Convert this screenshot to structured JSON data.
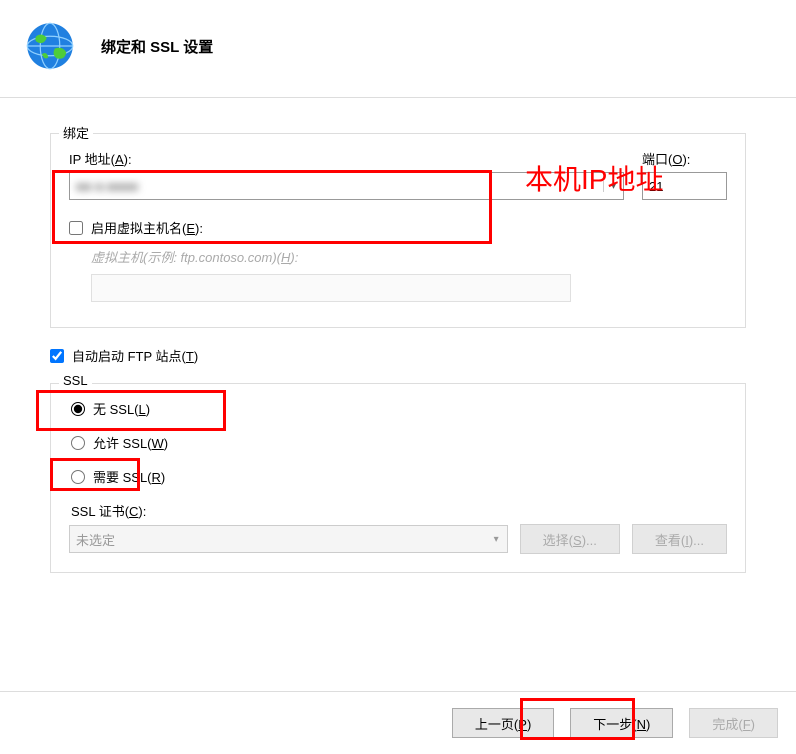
{
  "header": {
    "title": "绑定和 SSL 设置"
  },
  "binding": {
    "legend": "绑定",
    "ip_label_pre": "IP 地址(",
    "ip_hotkey": "A",
    "ip_label_post": "):",
    "ip_value": "■■  ■.■■■■",
    "port_label_pre": "端口(",
    "port_hotkey": "O",
    "port_label_post": "):",
    "port_value": "21",
    "vhost_enable_pre": "启用虚拟主机名(",
    "vhost_enable_hotkey": "E",
    "vhost_enable_post": "):",
    "vhost_enable_checked": false,
    "vhost_hint_pre": "虚拟主机(示例: ftp.contoso.com)(",
    "vhost_hint_hotkey": "H",
    "vhost_hint_post": "):"
  },
  "autostart": {
    "label_pre": "自动启动 FTP 站点(",
    "hotkey": "T",
    "label_post": ")",
    "checked": true
  },
  "ssl": {
    "legend": "SSL",
    "none_pre": "无 SSL(",
    "none_hotkey": "L",
    "none_post": ")",
    "allow_pre": "允许 SSL(",
    "allow_hotkey": "W",
    "allow_post": ")",
    "require_pre": "需要 SSL(",
    "require_hotkey": "R",
    "require_post": ")",
    "selected": "none",
    "cert_label_pre": "SSL 证书(",
    "cert_hotkey": "C",
    "cert_label_post": "):",
    "cert_value": "未选定",
    "btn_select_pre": "选择(",
    "btn_select_hotkey": "S",
    "btn_select_post": ")...",
    "btn_view_pre": "查看(",
    "btn_view_hotkey": "I",
    "btn_view_post": ")..."
  },
  "footer": {
    "prev_pre": "上一页(",
    "prev_hotkey": "P",
    "prev_post": ")",
    "next_pre": "下一步(",
    "next_hotkey": "N",
    "next_post": ")",
    "finish_pre": "完成(",
    "finish_hotkey": "F",
    "finish_post": ")"
  },
  "annotation": {
    "ip_label": "本机IP地址"
  }
}
